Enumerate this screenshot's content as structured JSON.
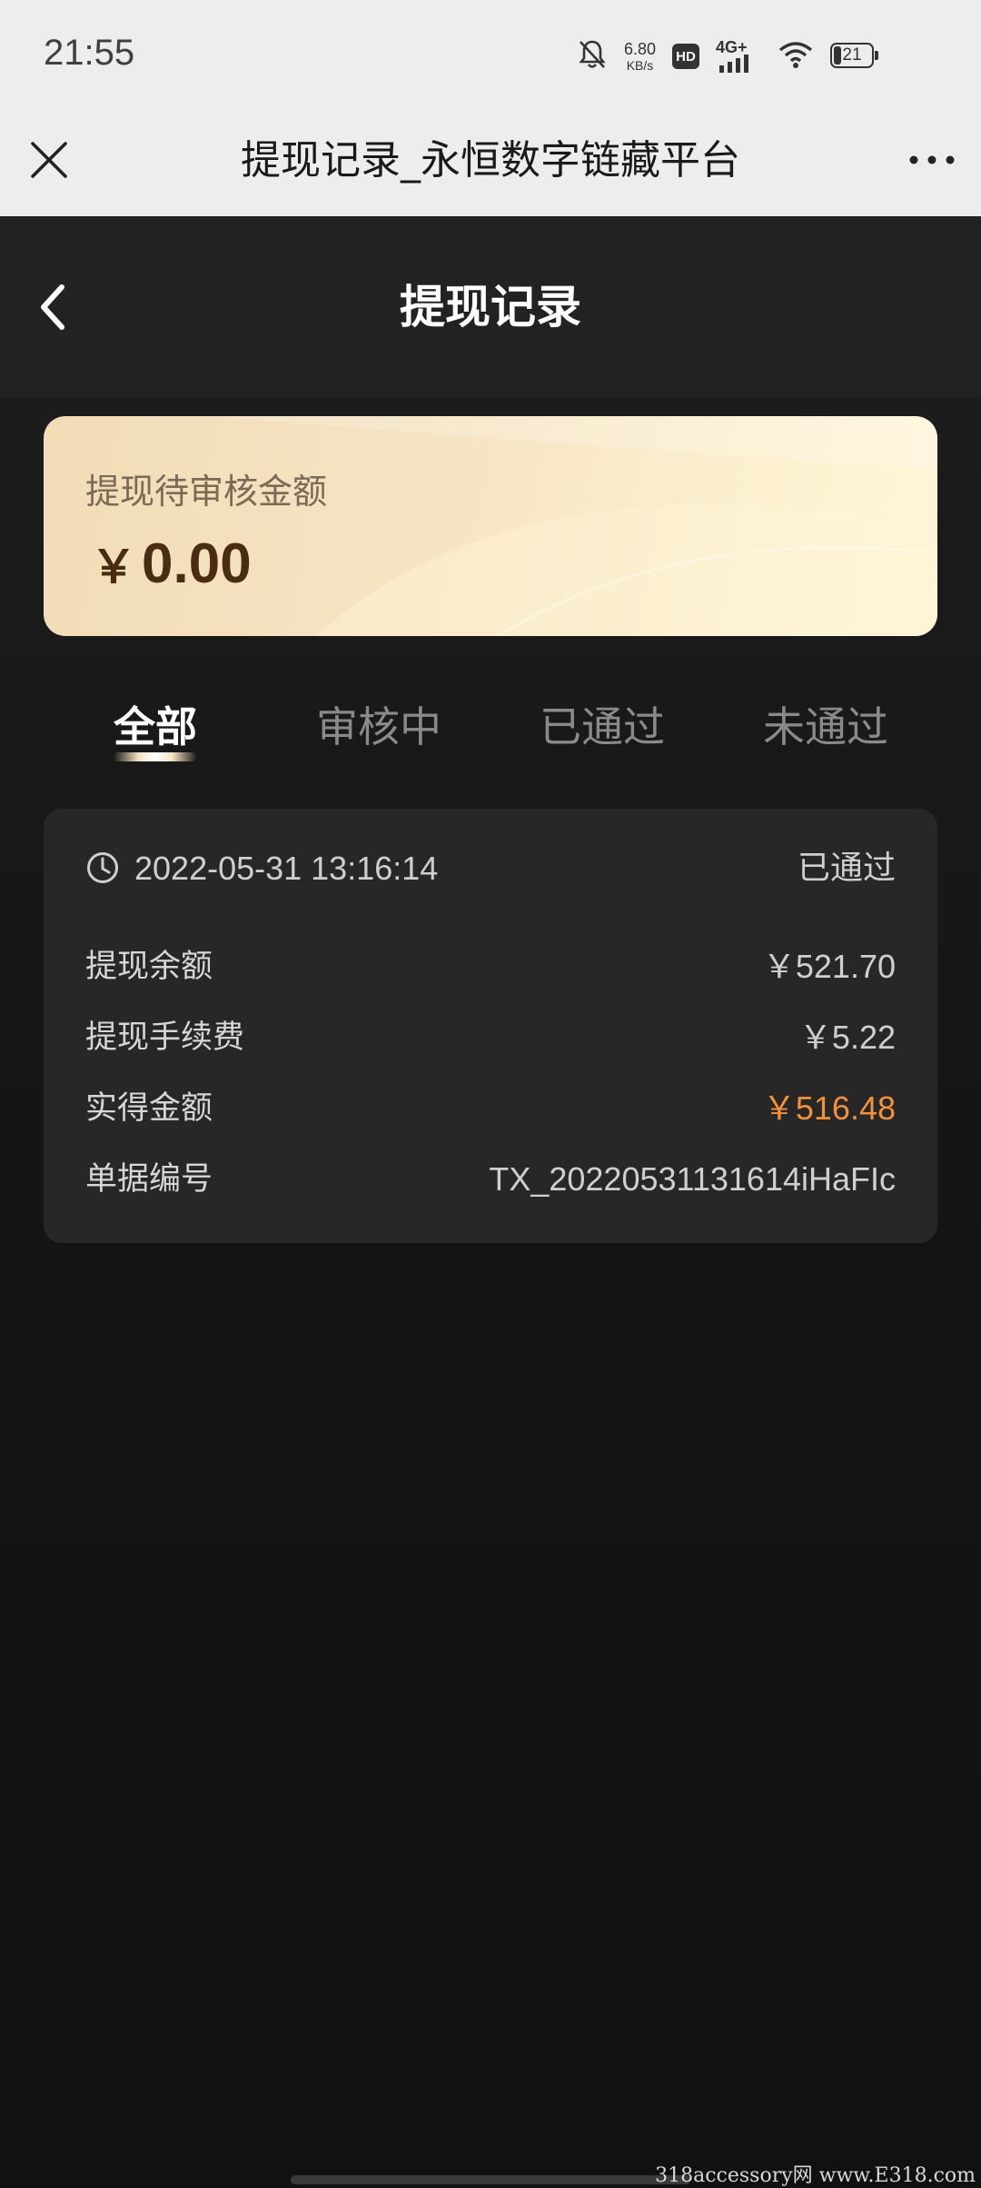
{
  "status_bar": {
    "time": "21:55",
    "net_speed_value": "6.80",
    "net_speed_unit": "KB/s",
    "hd_label": "HD",
    "network_label": "4G+",
    "battery_level": "21",
    "battery_fraction": 0.21
  },
  "browser": {
    "title": "提现记录_永恒数字链藏平台"
  },
  "header": {
    "title": "提现记录"
  },
  "pending": {
    "label": "提现待审核金额",
    "currency": "￥",
    "amount": "0.00"
  },
  "tabs": [
    {
      "label": "全部",
      "active": true
    },
    {
      "label": "审核中",
      "active": false
    },
    {
      "label": "已通过",
      "active": false
    },
    {
      "label": "未通过",
      "active": false
    }
  ],
  "record": {
    "time": "2022-05-31 13:16:14",
    "status": "已通过",
    "rows": [
      {
        "label": "提现余额",
        "value": "￥521.70"
      },
      {
        "label": "提现手续费",
        "value": "￥5.22"
      },
      {
        "label": "实得金额",
        "value": "￥516.48"
      },
      {
        "label": "单据编号",
        "value": "TX_20220531131614iHaFIc"
      }
    ]
  },
  "watermark": "318accessory网 www.E318.com",
  "colors": {
    "accent": "#f2913a",
    "card_gold": "#f6e4c4",
    "background": "#151515"
  }
}
